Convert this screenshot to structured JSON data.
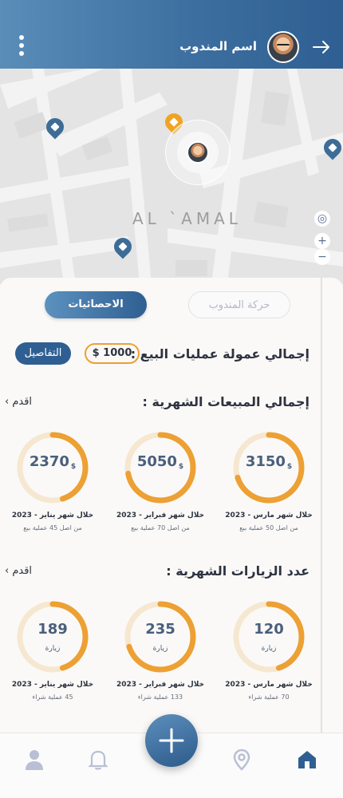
{
  "header": {
    "agent_name": "اسم المندوب",
    "icons": [
      "menu-dots-icon",
      "avatar",
      "arrow-right-icon"
    ]
  },
  "map": {
    "area_label": "AL `AMAL",
    "controls": [
      "locate-icon",
      "+",
      "−"
    ]
  },
  "tabs": [
    {
      "label": "حركة المندوب",
      "active": false
    },
    {
      "label": "الاحصائيات",
      "active": true
    }
  ],
  "commission": {
    "title": "إجمالي عمولة عمليات البيع :",
    "amount": "$ 1000",
    "details_label": "التفاصيل"
  },
  "sales": {
    "title": "إجمالي المبيعات الشهرية :",
    "prev_label": "اقدم",
    "items": [
      {
        "value": "3150",
        "unit": "$",
        "caption": "خلال شهر مارس - 2023",
        "sub": "من اصل 50 عملية بيع",
        "progress": 0.7
      },
      {
        "value": "5050",
        "unit": "$",
        "caption": "خلال شهر فبراير - 2023",
        "sub": "من اصل 70 عملية بيع",
        "progress": 0.72
      },
      {
        "value": "2370",
        "unit": "$",
        "caption": "خلال شهر يناير - 2023",
        "sub": "من اصل 45 عملية بيع",
        "progress": 0.45
      }
    ]
  },
  "visits": {
    "title": "عدد الزيارات الشهرية :",
    "prev_label": "اقدم",
    "items": [
      {
        "value": "120",
        "unit": "زيارة",
        "caption": "خلال شهر مارس - 2023",
        "sub": "70 عملية شراء",
        "progress": 0.45
      },
      {
        "value": "235",
        "unit": "زيارة",
        "caption": "خلال شهر فبراير - 2023",
        "sub": "133 عملية شراء",
        "progress": 0.7
      },
      {
        "value": "189",
        "unit": "زيارة",
        "caption": "خلال شهر يناير - 2023",
        "sub": "45 عملية شراء",
        "progress": 0.45
      }
    ]
  },
  "nav": {
    "items": [
      "home-icon",
      "location-icon",
      "add-icon",
      "bell-icon",
      "profile-icon"
    ],
    "active": "home-icon"
  },
  "colors": {
    "primary": "#2f5f92",
    "accent": "#eda033",
    "track": "#f6e7d0"
  }
}
